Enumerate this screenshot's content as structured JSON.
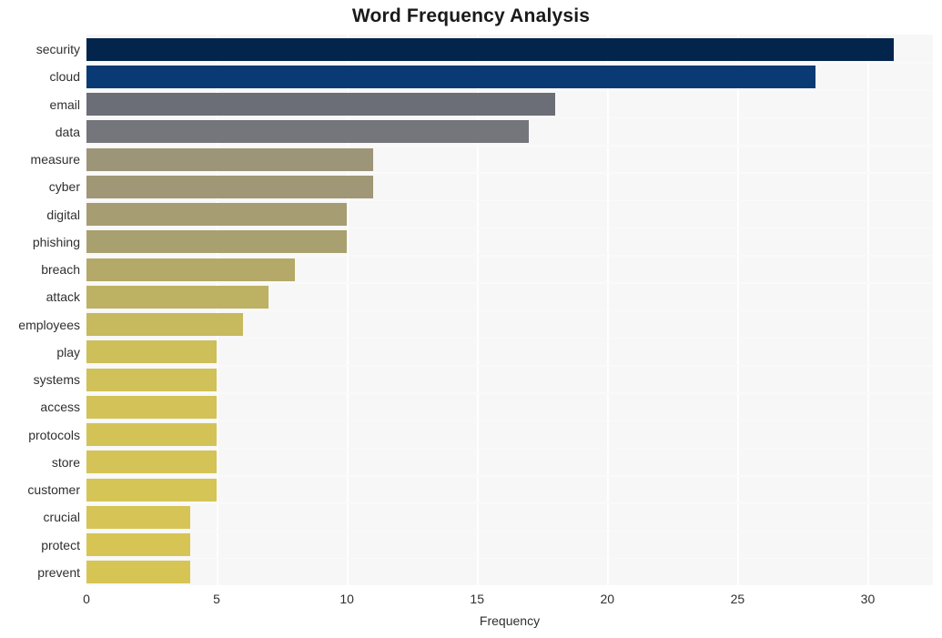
{
  "chart_data": {
    "type": "bar",
    "orientation": "horizontal",
    "title": "Word Frequency Analysis",
    "xlabel": "Frequency",
    "ylabel": "",
    "xlim": [
      0,
      32.5
    ],
    "xticks": [
      0,
      5,
      10,
      15,
      20,
      25,
      30
    ],
    "xtick_labels": [
      "0",
      "5",
      "10",
      "15",
      "20",
      "25",
      "30"
    ],
    "grid": true,
    "legend": false,
    "categories": [
      "security",
      "cloud",
      "email",
      "data",
      "measure",
      "cyber",
      "digital",
      "phishing",
      "breach",
      "attack",
      "employees",
      "play",
      "systems",
      "access",
      "protocols",
      "store",
      "customer",
      "crucial",
      "protect",
      "prevent"
    ],
    "values": [
      31,
      28,
      18,
      17,
      11,
      11,
      10,
      10,
      8,
      7,
      6,
      5,
      5,
      5,
      5,
      5,
      5,
      4,
      4,
      4
    ],
    "bar_colors": [
      "#03254c",
      "#0a3a73",
      "#6b6e76",
      "#74767c",
      "#9d9577",
      "#9f9775",
      "#a69d72",
      "#a9a070",
      "#b4a968",
      "#bdb163",
      "#c6b95e",
      "#cdbf5a",
      "#d0c158",
      "#d2c257",
      "#d3c357",
      "#d4c356",
      "#d5c456",
      "#d6c456",
      "#d6c555",
      "#d6c555"
    ],
    "plot_background": "#f7f7f7",
    "gridline_color": "#ffffff",
    "figure_background": "#ffffff"
  }
}
